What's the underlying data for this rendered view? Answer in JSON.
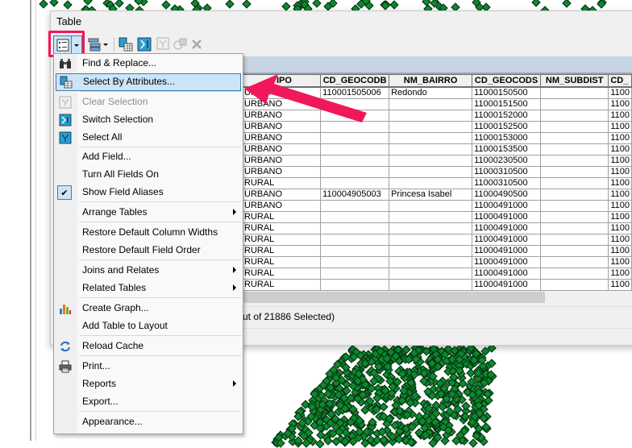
{
  "window": {
    "title": "Table"
  },
  "toolbar": {
    "buttons": [
      {
        "name": "table-options-icon"
      },
      {
        "name": "related-tables-icon"
      },
      {
        "name": "select-by-attributes-icon"
      },
      {
        "name": "switch-selection-icon"
      },
      {
        "name": "clear-selection-icon"
      },
      {
        "name": "zoom-to-selected-icon"
      },
      {
        "name": "delete-selected-icon"
      }
    ]
  },
  "menu": {
    "items": [
      {
        "label": "Find & Replace...",
        "icon": "binoculars"
      },
      {
        "label": "Select By Attributes...",
        "icon": "select-by-attributes",
        "hover": true
      },
      {
        "label": "Clear Selection",
        "icon": "clear-selection",
        "disabled": true
      },
      {
        "label": "Switch Selection",
        "icon": "switch-selection"
      },
      {
        "label": "Select All",
        "icon": "select-all"
      },
      {
        "label": "Add Field..."
      },
      {
        "label": "Turn All Fields On"
      },
      {
        "label": "Show Field Aliases",
        "checked": true
      },
      {
        "label": "Arrange Tables",
        "submenu": true
      },
      {
        "label": "Restore Default Column Widths"
      },
      {
        "label": "Restore Default Field Order"
      },
      {
        "label": "Joins and Relates",
        "submenu": true
      },
      {
        "label": "Related Tables",
        "submenu": true
      },
      {
        "label": "Create Graph...",
        "icon": "graph"
      },
      {
        "label": "Add Table to Layout"
      },
      {
        "label": "Reload Cache",
        "icon": "reload"
      },
      {
        "label": "Print...",
        "icon": "printer"
      },
      {
        "label": "Reports",
        "submenu": true
      },
      {
        "label": "Export..."
      },
      {
        "label": "Appearance..."
      }
    ]
  },
  "table": {
    "columns": [
      "TIPO",
      "CD_GEOCODB",
      "NM_BAIRRO",
      "CD_GEOCODS",
      "NM_SUBDIST",
      "CD_"
    ],
    "rows": [
      [
        "URBANO",
        "110001505006",
        "Redondo",
        "11000150500",
        "",
        "1100"
      ],
      [
        "URBANO",
        "",
        "",
        "11000151500",
        "",
        "1100"
      ],
      [
        "URBANO",
        "",
        "",
        "11000152000",
        "",
        "1100"
      ],
      [
        "URBANO",
        "",
        "",
        "11000152500",
        "",
        "1100"
      ],
      [
        "URBANO",
        "",
        "",
        "11000153000",
        "",
        "1100"
      ],
      [
        "URBANO",
        "",
        "",
        "11000153500",
        "",
        "1100"
      ],
      [
        "URBANO",
        "",
        "",
        "11000230500",
        "",
        "1100"
      ],
      [
        "URBANO",
        "",
        "",
        "11000310500",
        "",
        "1100"
      ],
      [
        "RURAL",
        "",
        "",
        "11000310500",
        "",
        "1100"
      ],
      [
        "URBANO",
        "110004905003",
        "Princesa Isabel",
        "11000490500",
        "",
        "1100"
      ],
      [
        "URBANO",
        "",
        "",
        "11000491000",
        "",
        "1100"
      ],
      [
        "RURAL",
        "",
        "",
        "11000491000",
        "",
        "1100"
      ],
      [
        "RURAL",
        "",
        "",
        "11000491000",
        "",
        "1100"
      ],
      [
        "RURAL",
        "",
        "",
        "11000491000",
        "",
        "1100"
      ],
      [
        "RURAL",
        "",
        "",
        "11000491000",
        "",
        "1100"
      ],
      [
        "RURAL",
        "",
        "",
        "11000491000",
        "",
        "1100"
      ],
      [
        "RURAL",
        "",
        "",
        "11000491000",
        "",
        "1100"
      ],
      [
        "RURAL",
        "",
        "",
        "11000491000",
        "",
        "1100"
      ]
    ]
  },
  "status": {
    "text": "ut of 21886 Selected)"
  },
  "colors": {
    "annotation": "#f0185a",
    "map_points": "#0b8a2f",
    "hover": "#cce4f7"
  }
}
